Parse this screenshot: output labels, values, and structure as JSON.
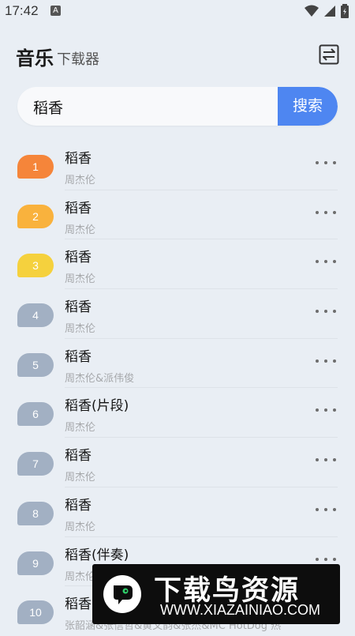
{
  "status_bar": {
    "time": "17:42",
    "notification_badge": "A"
  },
  "header": {
    "title": "音乐",
    "subtitle": "下载器"
  },
  "search": {
    "value": "稻香",
    "button_label": "搜索",
    "button_color": "#4e86f1"
  },
  "songs": [
    {
      "rank": "1",
      "title": "稻香",
      "artist": "周杰伦",
      "color": "#f5853a"
    },
    {
      "rank": "2",
      "title": "稻香",
      "artist": "周杰伦",
      "color": "#f9b23d"
    },
    {
      "rank": "3",
      "title": "稻香",
      "artist": "周杰伦",
      "color": "#f5d13d"
    },
    {
      "rank": "4",
      "title": "稻香",
      "artist": "周杰伦",
      "color": "#a2b0c3"
    },
    {
      "rank": "5",
      "title": "稻香",
      "artist": "周杰伦&派伟俊",
      "color": "#a2b0c3"
    },
    {
      "rank": "6",
      "title": "稻香(片段)",
      "artist": "周杰伦",
      "color": "#a2b0c3"
    },
    {
      "rank": "7",
      "title": "稻香",
      "artist": "周杰伦",
      "color": "#a2b0c3"
    },
    {
      "rank": "8",
      "title": "稻香",
      "artist": "周杰伦",
      "color": "#a2b0c3"
    },
    {
      "rank": "9",
      "title": "稻香(伴奏)",
      "artist": "周杰伦",
      "color": "#a2b0c3"
    },
    {
      "rank": "10",
      "title": "稻香",
      "artist": "张韶涵&张信哲&黄文韵&张杰&MC HotDog 热",
      "color": "#a2b0c3"
    }
  ],
  "watermark": {
    "title": "下载鸟资源",
    "url": "WWW.XIAZAINIAO.COM"
  }
}
